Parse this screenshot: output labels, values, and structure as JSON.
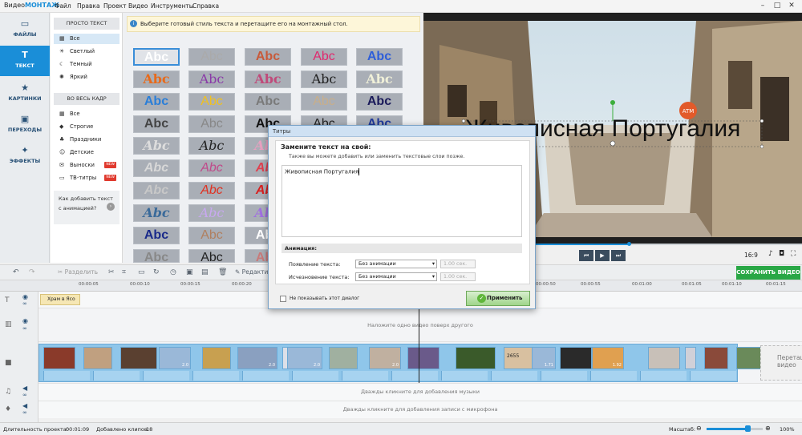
{
  "app": {
    "title_prefix": "Видео",
    "title_brand": "МОНТАЖ"
  },
  "menu": [
    "Файл",
    "Правка",
    "Проект",
    "Видео",
    "Инструменты",
    "Справка"
  ],
  "nav_tabs": [
    {
      "label": "ФАЙЛЫ",
      "icon": "folder-icon"
    },
    {
      "label": "ТЕКСТ",
      "icon": "text-t-icon"
    },
    {
      "label": "КАРТИНКИ",
      "icon": "star-icon"
    },
    {
      "label": "ПЕРЕХОДЫ",
      "icon": "transitions-icon"
    },
    {
      "label": "ЭФФЕКТЫ",
      "icon": "magic-wand-icon"
    }
  ],
  "style_panel": {
    "simple_text_header": "ПРОСТО ТЕКСТ",
    "simple_text_items": [
      "Все",
      "Светлый",
      "Темный",
      "Яркий"
    ],
    "full_frame_header": "ВО ВЕСЬ КАДР",
    "full_frame_items": [
      {
        "label": "Все",
        "badge": ""
      },
      {
        "label": "Строгие",
        "badge": ""
      },
      {
        "label": "Праздники",
        "badge": ""
      },
      {
        "label": "Детские",
        "badge": ""
      },
      {
        "label": "Выноски",
        "badge": "NEW"
      },
      {
        "label": "ТВ-титры",
        "badge": "NEW"
      }
    ],
    "howto_line1": "Как добавить текст",
    "howto_line2": "с анимацией?"
  },
  "tip": "Выберите готовый стиль текста и перетащите его на монтажный стол.",
  "tile_text": "Abc",
  "preview": {
    "overlay_text": "Живописная Португалия",
    "aspect": "16:9",
    "save_button": "СОХРАНИТЬ ВИДЕО"
  },
  "toolbar": {
    "split_label": "Разделить",
    "edit_label": "Редакти"
  },
  "ruler_labels": [
    "00:00:05",
    "00:00:10",
    "00:00:15",
    "00:00:20",
    "00:00:50",
    "00:00:55",
    "00:01:00",
    "00:01:05",
    "00:01:10",
    "00:01:15"
  ],
  "timeline": {
    "title_clip": "Храм в Ясо",
    "overlay_hint": "Наложите одно видео поверх другого",
    "drop_hint": "Перетащите видео",
    "music_hint": "Дважды кликните для добавления музыки",
    "mic_hint": "Дважды кликните для добавления записи с микрофона",
    "clip_durations": [
      "2.0",
      "2.0",
      "2.0",
      "2.0",
      "1.71",
      "2.0",
      "1.92",
      "2.0"
    ],
    "counter": "2655"
  },
  "status": {
    "duration_label": "Длительность проекта:",
    "duration_value": "00:01:09",
    "clips_label": "Добавлено клипов:",
    "clips_value": "18",
    "scale_label": "Масштаб:",
    "zoom_value": "100%"
  },
  "dialog": {
    "window_title": "Титры",
    "heading": "Замените текст на свой:",
    "subheading": "Также вы можете добавить или заменить текстовые слои позже.",
    "text_value": "Живописная Португалия",
    "animation_header": "Анимация:",
    "appear_label": "Появление текста:",
    "disappear_label": "Исчезновение текста:",
    "appear_value": "Без анимации",
    "disappear_value": "Без анимации",
    "appear_duration": "1.00 сек.",
    "disappear_duration": "1.00 сек.",
    "dont_show": "Не показывать этот диалог",
    "apply_button": "Применить"
  },
  "colors": {
    "accent": "#1a8ed8",
    "save_green": "#29a745",
    "new_badge": "#e03a2e",
    "apply_green": "#5fb63a"
  }
}
